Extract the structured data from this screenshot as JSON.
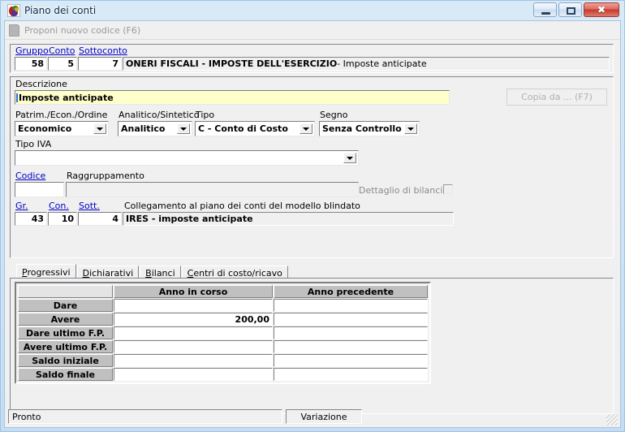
{
  "window": {
    "title": "Piano dei conti",
    "app_icon": "chart-of-accounts-icon",
    "minimize_label": "–",
    "maximize_label": "□",
    "close_label": "✖"
  },
  "toolbar": {
    "propose_label": "Proponi nuovo codice (F6)",
    "propose_icon": "new-document-icon"
  },
  "account_key": {
    "labels": {
      "gruppo": "Gruppo",
      "conto": "Conto",
      "sottoconto": "Sottoconto"
    },
    "gruppo": "58",
    "conto": "5",
    "sottoconto": "7",
    "description_bold": "ONERI FISCALI - IMPOSTE DELL'ESERCIZIO",
    "description_rest": " - Imposte anticipate"
  },
  "details": {
    "descrizione_label": "Descrizione",
    "descrizione_value": "Imposte anticipate",
    "copia_da_label": "Copia da ... (F7)",
    "patrim_label": "Patrim./Econ./Ordine",
    "patrim_value": "Economico",
    "analitico_label": "Analitico/Sintetico",
    "analitico_value": "Analitico",
    "tipo_label": "Tipo",
    "tipo_value": "C - Conto di Costo",
    "segno_label": "Segno",
    "segno_value": "Senza Controllo",
    "tipo_iva_label": "Tipo IVA",
    "tipo_iva_value": "",
    "codice_label": "Codice",
    "codice_value": "",
    "raggruppamento_label": "Raggruppamento",
    "raggruppamento_value": "",
    "dettaglio_label": "Dettaglio di bilancio",
    "dettaglio_checked": false
  },
  "blindato": {
    "labels": {
      "gr": "Gr.",
      "con": "Con.",
      "sott": "Sott."
    },
    "caption": "Collegamento al piano dei conti del modello blindato",
    "gr": "43",
    "con": "10",
    "sott": "4",
    "description": "IRES - imposte anticipate"
  },
  "tabs": [
    {
      "label": "Progressivi",
      "mnemonic": "P",
      "active": true
    },
    {
      "label": "Dichiarativi",
      "mnemonic": "D",
      "active": false
    },
    {
      "label": "Bilanci",
      "mnemonic": "B",
      "active": false
    },
    {
      "label": "Centri di costo/ricavo",
      "mnemonic": "C",
      "active": false
    }
  ],
  "table": {
    "corner": "",
    "columns": [
      "Anno in corso",
      "Anno precedente"
    ],
    "rows": [
      {
        "label": "Dare",
        "anno_in_corso": "",
        "anno_precedente": ""
      },
      {
        "label": "Avere",
        "anno_in_corso": "200,00",
        "anno_precedente": ""
      },
      {
        "label": "Dare ultimo F.P.",
        "anno_in_corso": "",
        "anno_precedente": ""
      },
      {
        "label": "Avere ultimo F.P.",
        "anno_in_corso": "",
        "anno_precedente": ""
      },
      {
        "label": "Saldo iniziale",
        "anno_in_corso": "",
        "anno_precedente": ""
      },
      {
        "label": "Saldo finale",
        "anno_in_corso": "",
        "anno_precedente": ""
      }
    ]
  },
  "statusbar": {
    "message": "Pronto",
    "mode": "Variazione"
  },
  "colors": {
    "window_frame": "#c5dcf2",
    "client_bg": "#f0f0f0",
    "link": "#0000c8",
    "highlight_field": "#ffffcc",
    "close_button": "#c2392c"
  }
}
